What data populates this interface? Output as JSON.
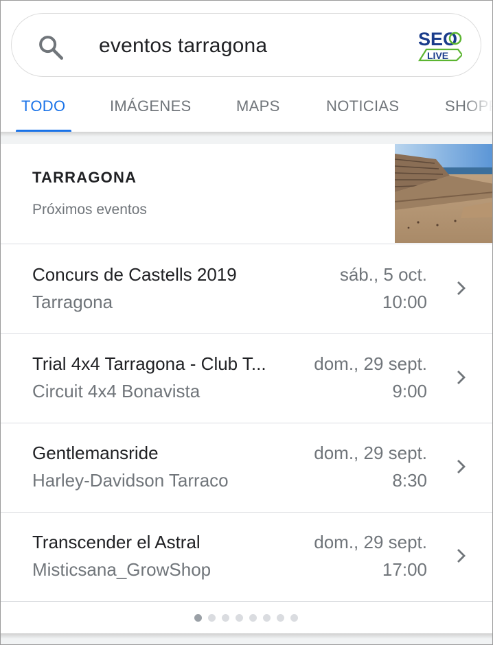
{
  "search": {
    "query": "eventos tarragona",
    "search_icon": "search-icon",
    "logo": {
      "line1": "SEO",
      "line2": "LIVE",
      "primary_color": "#1a3c8b",
      "accent_color": "#5cb531"
    }
  },
  "tabs": [
    {
      "label": "TODO",
      "active": true
    },
    {
      "label": "IMÁGENES",
      "active": false
    },
    {
      "label": "MAPS",
      "active": false
    },
    {
      "label": "NOTICIAS",
      "active": false
    },
    {
      "label": "SHOPPING",
      "active": false
    }
  ],
  "card": {
    "title": "TARRAGONA",
    "subtitle": "Próximos eventos",
    "events": [
      {
        "name": "Concurs de Castells 2019",
        "venue": "Tarragona",
        "date": "sáb., 5 oct.",
        "time": "10:00"
      },
      {
        "name": "Trial 4x4 Tarragona - Club T...",
        "venue": "Circuit 4x4 Bonavista",
        "date": "dom., 29 sept.",
        "time": "9:00"
      },
      {
        "name": "Gentlemansride",
        "venue": "Harley-Davidson Tarraco",
        "date": "dom., 29 sept.",
        "time": "8:30"
      },
      {
        "name": "Transcender el Astral",
        "venue": "Misticsana_GrowShop",
        "date": "dom., 29 sept.",
        "time": "17:00"
      }
    ],
    "pagination": {
      "pages": 8,
      "current": 1
    }
  },
  "colors": {
    "accent": "#1a73e8",
    "text_primary": "#202124",
    "text_secondary": "#70757a",
    "divider": "#dadce0"
  }
}
